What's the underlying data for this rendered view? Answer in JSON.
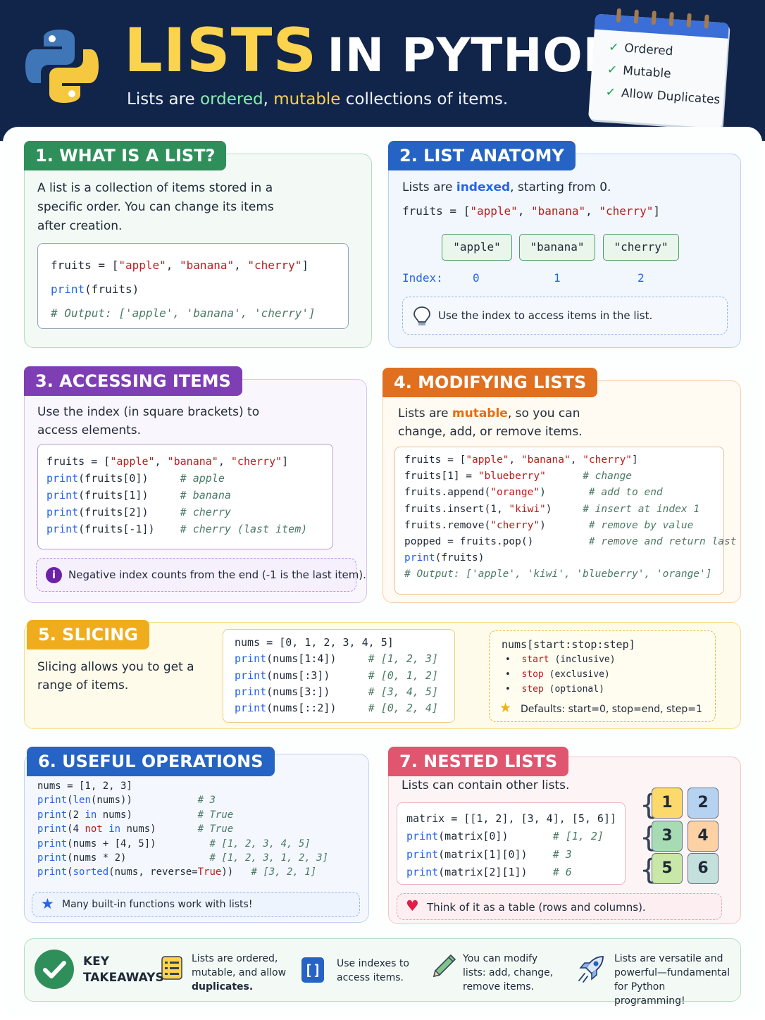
{
  "header": {
    "title_main": "LISTS",
    "title_rest": "IN PYTHON",
    "subtitle_pre": "Lists are ",
    "subtitle_w1": "ordered",
    "subtitle_mid": ", ",
    "subtitle_w2": "mutable",
    "subtitle_post": " collections of items.",
    "checklist": [
      "Ordered",
      "Mutable",
      "Allow Duplicates"
    ]
  },
  "s1": {
    "tag": "1. WHAT IS A LIST?",
    "text": "A list is a collection of items stored in a specific order. You can change its items after creation.",
    "code": [
      [
        [
          "fruits = [",
          ""
        ],
        [
          "\"apple\"",
          "str"
        ],
        [
          ", ",
          ""
        ],
        [
          "\"banana\"",
          "str"
        ],
        [
          ", ",
          ""
        ],
        [
          "\"cherry\"",
          "str"
        ],
        [
          "]",
          ""
        ]
      ],
      [
        [
          "print",
          "kw"
        ],
        [
          "(fruits)",
          ""
        ]
      ],
      [
        [
          "# Output: ['apple', 'banana', 'cherry']",
          "cm"
        ]
      ]
    ]
  },
  "s2": {
    "tag": "2. LIST ANATOMY",
    "text_pre": "Lists are ",
    "text_hl": "indexed",
    "text_post": ", starting from 0.",
    "code": [
      [
        [
          "fruits = [",
          ""
        ],
        [
          "\"apple\"",
          "str"
        ],
        [
          ", ",
          ""
        ],
        [
          "\"banana\"",
          "str"
        ],
        [
          ", ",
          ""
        ],
        [
          "\"cherry\"",
          "str"
        ],
        [
          "]",
          ""
        ]
      ]
    ],
    "boxes": [
      "\"apple\"",
      "\"banana\"",
      "\"cherry\""
    ],
    "index_label": "Index:",
    "indices": [
      "0",
      "1",
      "2"
    ],
    "note": "Use the index to access items in the list."
  },
  "s3": {
    "tag": "3. ACCESSING ITEMS",
    "text": "Use the index (in square brackets) to access elements.",
    "code": [
      [
        [
          "fruits = [",
          ""
        ],
        [
          "\"apple\"",
          "str"
        ],
        [
          ", ",
          ""
        ],
        [
          "\"banana\"",
          "str"
        ],
        [
          ", ",
          ""
        ],
        [
          "\"cherry\"",
          "str"
        ],
        [
          "]",
          ""
        ]
      ],
      [
        [
          "print",
          "kw"
        ],
        [
          "(fruits[0])     ",
          ""
        ],
        [
          "# apple",
          "cm"
        ]
      ],
      [
        [
          "print",
          "kw"
        ],
        [
          "(fruits[1])     ",
          ""
        ],
        [
          "# banana",
          "cm"
        ]
      ],
      [
        [
          "print",
          "kw"
        ],
        [
          "(fruits[2])     ",
          ""
        ],
        [
          "# cherry",
          "cm"
        ]
      ],
      [
        [
          "print",
          "kw"
        ],
        [
          "(fruits[-1])    ",
          ""
        ],
        [
          "# cherry (last item)",
          "cm"
        ]
      ]
    ],
    "note": "Negative index counts from the end (-1 is the last item)."
  },
  "s4": {
    "tag": "4. MODIFYING LISTS",
    "text_pre": "Lists are ",
    "text_hl": "mutable",
    "text_post": ", so you can change, add, or remove items.",
    "code": [
      [
        [
          "fruits = [",
          ""
        ],
        [
          "\"apple\"",
          "str"
        ],
        [
          ", ",
          ""
        ],
        [
          "\"banana\"",
          "str"
        ],
        [
          ", ",
          ""
        ],
        [
          "\"cherry\"",
          "str"
        ],
        [
          "]",
          ""
        ]
      ],
      [
        [
          "fruits[1] = ",
          ""
        ],
        [
          "\"blueberry\"",
          "str"
        ],
        [
          "      ",
          ""
        ],
        [
          "# change",
          "cm"
        ]
      ],
      [
        [
          "fruits.append(",
          ""
        ],
        [
          "\"orange\"",
          "str"
        ],
        [
          ")       ",
          ""
        ],
        [
          "# add to end",
          "cm"
        ]
      ],
      [
        [
          "fruits.insert(1, ",
          ""
        ],
        [
          "\"kiwi\"",
          "str"
        ],
        [
          ")     ",
          ""
        ],
        [
          "# insert at index 1",
          "cm"
        ]
      ],
      [
        [
          "fruits.remove(",
          ""
        ],
        [
          "\"cherry\"",
          "str"
        ],
        [
          ")       ",
          ""
        ],
        [
          "# remove by value",
          "cm"
        ]
      ],
      [
        [
          "popped = fruits.pop()         ",
          ""
        ],
        [
          "# remove and return last",
          "cm"
        ]
      ],
      [
        [
          "print",
          "kw"
        ],
        [
          "(fruits)",
          ""
        ]
      ],
      [
        [
          "# Output: ['apple', 'kiwi', 'blueberry', 'orange']",
          "cm"
        ]
      ]
    ]
  },
  "s5": {
    "tag": "5. SLICING",
    "text": "Slicing allows you to get a range of items.",
    "code": [
      [
        [
          "nums = [0, 1, 2, 3, 4, 5]",
          ""
        ]
      ],
      [
        [
          "print",
          "kw"
        ],
        [
          "(nums[1:4])     ",
          ""
        ],
        [
          "# [1, 2, 3]",
          "cm"
        ]
      ],
      [
        [
          "print",
          "kw"
        ],
        [
          "(nums[:3])      ",
          ""
        ],
        [
          "# [0, 1, 2]",
          "cm"
        ]
      ],
      [
        [
          "print",
          "kw"
        ],
        [
          "(nums[3:])      ",
          ""
        ],
        [
          "# [3, 4, 5]",
          "cm"
        ]
      ],
      [
        [
          "print",
          "kw"
        ],
        [
          "(nums[::2])     ",
          ""
        ],
        [
          "# [0, 2, 4]",
          "cm"
        ]
      ]
    ],
    "syntax": "nums[start:stop:step]",
    "params": [
      {
        "name": "start",
        "desc": "(inclusive)"
      },
      {
        "name": "stop",
        "desc": "(exclusive)"
      },
      {
        "name": "step",
        "desc": "(optional)"
      }
    ],
    "defaults": "Defaults: start=0, stop=end, step=1"
  },
  "s6": {
    "tag": "6. USEFUL OPERATIONS",
    "code": [
      [
        [
          "nums = [1, 2, 3]",
          ""
        ]
      ],
      [
        [
          "print",
          "kw"
        ],
        [
          "(",
          ""
        ],
        [
          "len",
          "kw"
        ],
        [
          "(nums))           ",
          ""
        ],
        [
          "# 3",
          "cm"
        ]
      ],
      [
        [
          "print",
          "kw"
        ],
        [
          "(2 ",
          ""
        ],
        [
          "in",
          "kw"
        ],
        [
          " nums)           ",
          ""
        ],
        [
          "# True",
          "cm"
        ]
      ],
      [
        [
          "print",
          "kw"
        ],
        [
          "(4 ",
          ""
        ],
        [
          "not",
          "str"
        ],
        [
          " ",
          ""
        ],
        [
          "in",
          "kw"
        ],
        [
          " nums)       ",
          ""
        ],
        [
          "# True",
          "cm"
        ]
      ],
      [
        [
          "print",
          "kw"
        ],
        [
          "(nums + [4, 5])         ",
          ""
        ],
        [
          "# [1, 2, 3, 4, 5]",
          "cm"
        ]
      ],
      [
        [
          "print",
          "kw"
        ],
        [
          "(nums * 2)              ",
          ""
        ],
        [
          "# [1, 2, 3, 1, 2, 3]",
          "cm"
        ]
      ],
      [
        [
          "print",
          "kw"
        ],
        [
          "(",
          ""
        ],
        [
          "sorted",
          "kw"
        ],
        [
          "(nums, reverse=",
          ""
        ],
        [
          "True",
          "str"
        ],
        [
          "))   ",
          ""
        ],
        [
          "# [3, 2, 1]",
          "cm"
        ]
      ]
    ],
    "note": "Many built-in functions work with lists!"
  },
  "s7": {
    "tag": "7. NESTED LISTS",
    "text": "Lists can contain other lists.",
    "code": [
      [
        [
          "matrix = [[1, 2], [3, 4], [5, 6]]",
          ""
        ]
      ],
      [
        [
          "print",
          "kw"
        ],
        [
          "(matrix[0])       ",
          ""
        ],
        [
          "# [1, 2]",
          "cm"
        ]
      ],
      [
        [
          "print",
          "kw"
        ],
        [
          "(matrix[1][0])    ",
          ""
        ],
        [
          "# 3",
          "cm"
        ]
      ],
      [
        [
          "print",
          "kw"
        ],
        [
          "(matrix[2][1])    ",
          ""
        ],
        [
          "# 6",
          "cm"
        ]
      ]
    ],
    "matrix": [
      "1",
      "2",
      "3",
      "4",
      "5",
      "6"
    ],
    "note": "Think of it as a table (rows and columns)."
  },
  "takeaways": {
    "title_1": "KEY",
    "title_2": "TAKEAWAYS",
    "t1_pre": "Lists are ordered, mutable, and allow",
    "t1_bold": "duplicates.",
    "t2": "Use indexes to access items.",
    "t3": "You can modify lists: add, change, remove items.",
    "t4": "Lists are versatile and powerful—fundamental for Python programming!"
  },
  "colors": {
    "header_bg": "#11244a",
    "title_yellow": "#fbd34d",
    "s1": "#2f8f5b",
    "s2": "#2563c4",
    "s3": "#7e3fb5",
    "s4": "#e0701f",
    "s5": "#efac1d",
    "s6": "#2563c4",
    "s7": "#e0566f"
  },
  "icons": [
    "python-logo",
    "check-icon",
    "lightbulb-icon",
    "info-icon",
    "star-icon",
    "heart-icon",
    "list-icon",
    "brackets-icon",
    "pencil-icon",
    "rocket-icon"
  ]
}
